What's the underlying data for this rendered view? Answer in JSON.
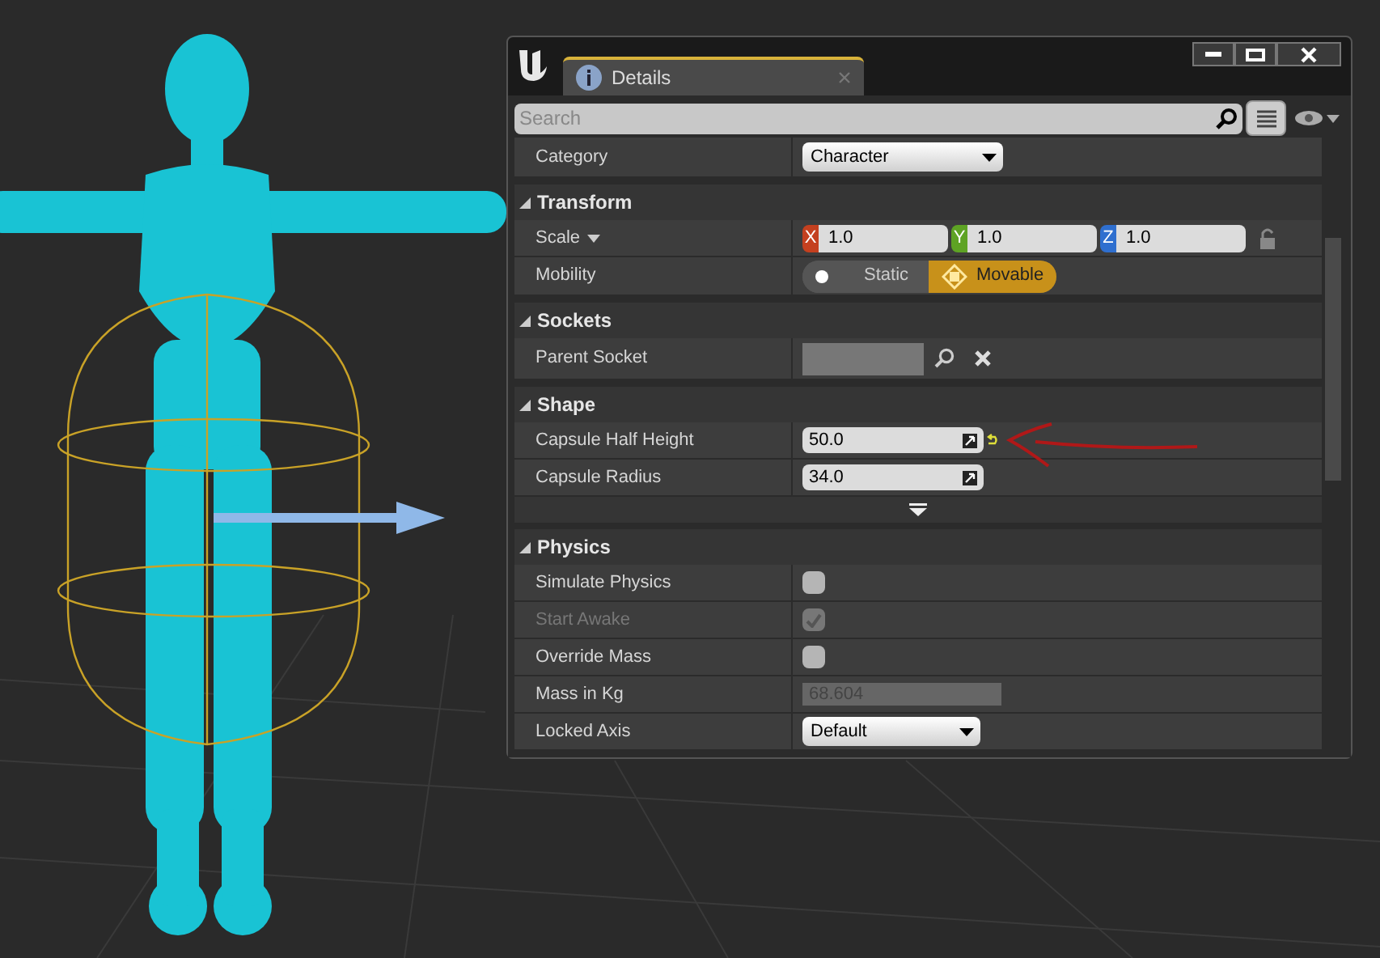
{
  "tab": {
    "label": "Details",
    "selected": true
  },
  "search": {
    "placeholder": "Search"
  },
  "category": {
    "label": "Category",
    "value": "Character"
  },
  "sections": [
    {
      "title": "Transform",
      "expanded": true,
      "rows": [
        {
          "kind": "vector",
          "label": "Scale",
          "fields": [
            {
              "axis": "X",
              "value": "1.0",
              "color": "#c4401f"
            },
            {
              "axis": "Y",
              "value": "1.0",
              "color": "#5ea324"
            },
            {
              "axis": "Z",
              "value": "1.0",
              "color": "#2f6fcf"
            }
          ]
        },
        {
          "kind": "toggle",
          "label": "Mobility",
          "options": [
            {
              "label": "Static",
              "selected": false
            },
            {
              "label": "Movable",
              "selected": true
            }
          ]
        }
      ]
    },
    {
      "title": "Sockets",
      "expanded": true,
      "rows": [
        {
          "kind": "picker",
          "label": "Parent Socket"
        }
      ]
    },
    {
      "title": "Shape",
      "expanded": true,
      "advanced": true,
      "rows": [
        {
          "kind": "number",
          "label": "Capsule Half Height",
          "value": "50.0",
          "modified": true,
          "disabled": false
        },
        {
          "kind": "number",
          "label": "Capsule Radius",
          "value": "34.0",
          "modified": false,
          "disabled": false
        }
      ]
    },
    {
      "title": "Physics",
      "expanded": true,
      "rows": [
        {
          "kind": "checkbox",
          "label": "Simulate Physics",
          "checked": false,
          "disabled": false
        },
        {
          "kind": "checkbox",
          "label": "Start Awake",
          "checked": true,
          "disabled": true
        },
        {
          "kind": "checkbox",
          "label": "Override Mass",
          "checked": false,
          "disabled": false
        },
        {
          "kind": "number",
          "label": "Mass in Kg",
          "value": "68.604",
          "disabled": true
        },
        {
          "kind": "dropdown",
          "label": "Locked Axis",
          "value": "Default"
        }
      ]
    }
  ]
}
